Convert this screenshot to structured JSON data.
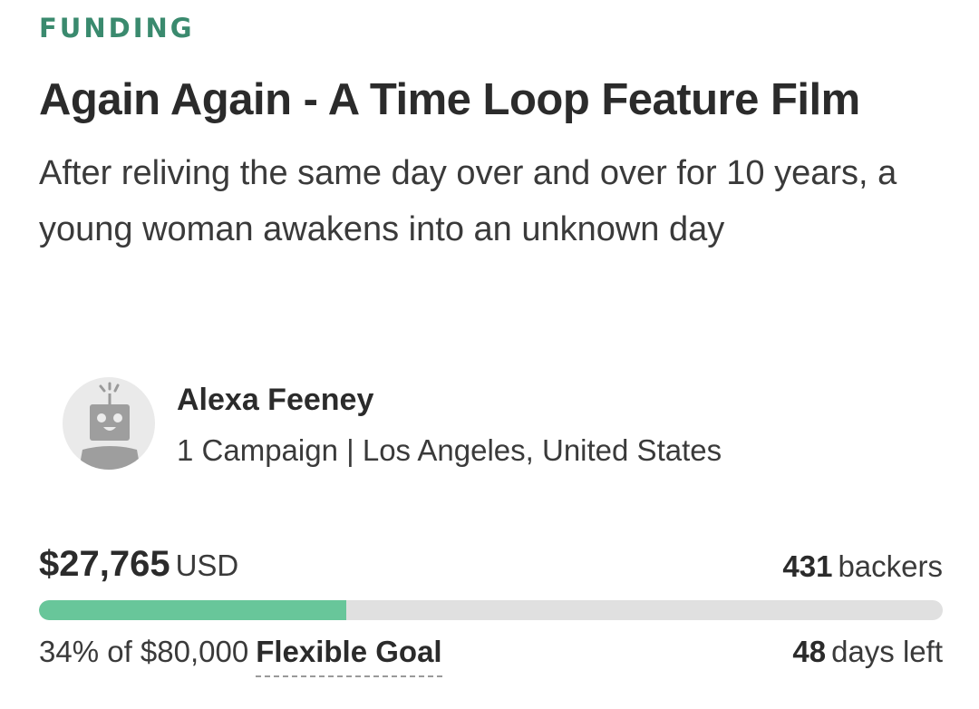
{
  "campaign": {
    "category": "FUNDING",
    "title": "Again Again - A Time Loop Feature Film",
    "tagline": "After reliving the same day over and over for 10 years, a young woman awakens into an unknown day"
  },
  "owner": {
    "avatar_icon": "robot-avatar-icon",
    "name": "Alexa Feeney",
    "meta": "1 Campaign | Los Angeles, United States"
  },
  "funding": {
    "amount": "$27,765",
    "currency": "USD",
    "backers_count": "431",
    "backers_label": "backers",
    "progress_fraction": 0.34,
    "percent_text": "34% of $80,000",
    "goal_type": "Flexible Goal",
    "days_count": "48",
    "days_label": "days left"
  },
  "colors": {
    "category": "#3a8a6e",
    "progress_fill": "#68c69a",
    "progress_track": "#e0e0e0"
  }
}
